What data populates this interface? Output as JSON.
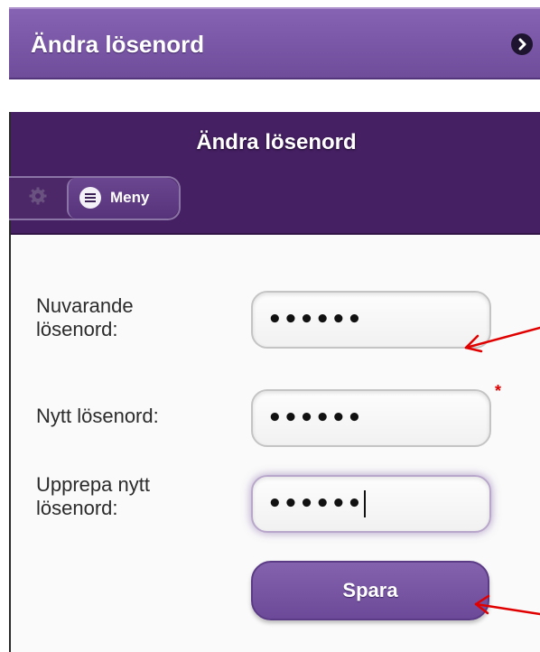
{
  "list_item": {
    "label": "Ändra lösenord",
    "chevron_icon": "chevron-right-circle-icon"
  },
  "header": {
    "title": "Ändra lösenord",
    "settings_icon": "gear-icon",
    "menu_icon": "hamburger-icon",
    "menu_label": "Meny"
  },
  "form": {
    "current_password": {
      "label": "Nuvarande lösenord:",
      "value": "••••••"
    },
    "new_password": {
      "label": "Nytt lösenord:",
      "value": "••••••"
    },
    "repeat_password": {
      "label": "Upprepa nytt lösenord:",
      "value": "••••••",
      "required_marker": "*"
    },
    "save_label": "Spara"
  },
  "colors": {
    "brand_purple": "#452062",
    "list_purple": "#7a57a6",
    "button_purple": "#7655a3",
    "annotation_arrow": "#e00000",
    "required_star": "#e00000"
  }
}
